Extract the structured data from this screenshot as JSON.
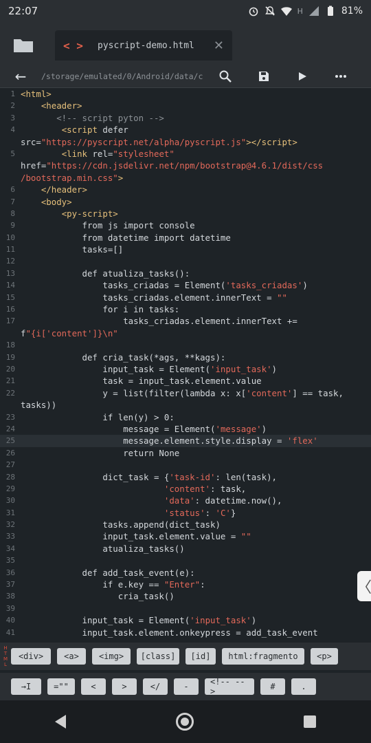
{
  "status_bar": {
    "time": "22:07",
    "battery": "81%",
    "network": "H"
  },
  "tab": {
    "icon": "< >",
    "filename": "pyscript-demo.html",
    "close_glyph": "✕"
  },
  "path_bar": {
    "path": "/storage/emulated/0/Android/data/c"
  },
  "code_lines": [
    {
      "n": "1",
      "html": "<span class='tag'>&lt;html&gt;</span>"
    },
    {
      "n": "2",
      "html": "    <span class='tag'>&lt;header&gt;</span>"
    },
    {
      "n": "3",
      "html": "       <span class='cm'>&lt;!-- script pyton --&gt;</span>"
    },
    {
      "n": "4",
      "html": "        <span class='tag'>&lt;script</span> defer"
    },
    {
      "n": "",
      "html": "src=<span class='str'>\"https://pyscript.net/alpha/pyscript.js\"</span><span class='tag'>&gt;&lt;/script&gt;</span>"
    },
    {
      "n": "5",
      "html": "        <span class='tag'>&lt;link</span> rel=<span class='str'>\"stylesheet\"</span>"
    },
    {
      "n": "",
      "html": "href=<span class='str'>\"https://cdn.jsdelivr.net/npm/bootstrap@4.6.1/dist/css</span>"
    },
    {
      "n": "",
      "html": "<span class='str'>/bootstrap.min.css\"</span><span class='tag'>&gt;</span>"
    },
    {
      "n": "6",
      "html": "    <span class='tag'>&lt;/header&gt;</span>"
    },
    {
      "n": "7",
      "html": "    <span class='tag'>&lt;body&gt;</span>"
    },
    {
      "n": "8",
      "html": "        <span class='tag'>&lt;py-script&gt;</span>"
    },
    {
      "n": "9",
      "html": "            from js import console"
    },
    {
      "n": "10",
      "html": "            from datetime import datetime"
    },
    {
      "n": "11",
      "html": "            tasks=[]"
    },
    {
      "n": "12",
      "html": ""
    },
    {
      "n": "13",
      "html": "            def atualiza_tasks():"
    },
    {
      "n": "14",
      "html": "                tasks_criadas = Element(<span class='str'>'tasks_criadas'</span>)"
    },
    {
      "n": "15",
      "html": "                tasks_criadas.element.innerText = <span class='str'>\"\"</span>"
    },
    {
      "n": "16",
      "html": "                for i in tasks:"
    },
    {
      "n": "17",
      "html": "                    tasks_criadas.element.innerText +="
    },
    {
      "n": "",
      "html": "f<span class='str'>\"{i['content']}\\n\"</span>"
    },
    {
      "n": "18",
      "html": ""
    },
    {
      "n": "19",
      "html": "            def cria_task(*ags, **kags):"
    },
    {
      "n": "20",
      "html": "                input_task = Element(<span class='str'>'input_task'</span>)"
    },
    {
      "n": "21",
      "html": "                task = input_task.element.value"
    },
    {
      "n": "22",
      "html": "                y = list(filter(lambda x: x[<span class='str'>'content'</span>] == task,"
    },
    {
      "n": "",
      "html": "tasks))"
    },
    {
      "n": "23",
      "html": "                if len(y) &gt; 0:"
    },
    {
      "n": "24",
      "html": "                    message = Element(<span class='str'>'message'</span>)"
    },
    {
      "n": "25",
      "html": "                    message.element.style.display = <span class='str'>'flex'</span>",
      "hl": true
    },
    {
      "n": "26",
      "html": "                    return None"
    },
    {
      "n": "27",
      "html": ""
    },
    {
      "n": "28",
      "html": "                dict_task = {<span class='str'>'task-id'</span>: len(task),"
    },
    {
      "n": "29",
      "html": "                            <span class='str'>'content'</span>: task,"
    },
    {
      "n": "30",
      "html": "                            <span class='str'>'data'</span>: datetime.now(),"
    },
    {
      "n": "31",
      "html": "                            <span class='str'>'status'</span>: <span class='str'>'C'</span>}"
    },
    {
      "n": "32",
      "html": "                tasks.append(dict_task)"
    },
    {
      "n": "33",
      "html": "                input_task.element.value = <span class='str'>\"\"</span>"
    },
    {
      "n": "34",
      "html": "                atualiza_tasks()"
    },
    {
      "n": "35",
      "html": ""
    },
    {
      "n": "36",
      "html": "            def add_task_event(e):"
    },
    {
      "n": "37",
      "html": "                if e.key == <span class='str'>\"Enter\"</span>:"
    },
    {
      "n": "38",
      "html": "                   cria_task()"
    },
    {
      "n": "39",
      "html": ""
    },
    {
      "n": "40",
      "html": "            input_task = Element(<span class='str'>'input_task'</span>)"
    },
    {
      "n": "41",
      "html": "            input_task.element.onkeypress = add_task_event"
    }
  ],
  "snippets_row1": [
    "<div>",
    "<a>",
    "<img>",
    "[class]",
    "[id]",
    "html:fragmento",
    "<p>"
  ],
  "snippets_row2": [
    "→I",
    "=\"\"",
    "<",
    ">",
    "</",
    "-",
    "<!-- -->",
    "#",
    "."
  ],
  "mode_label": [
    "H",
    "T",
    "M",
    "L"
  ],
  "side_handle": "〈"
}
